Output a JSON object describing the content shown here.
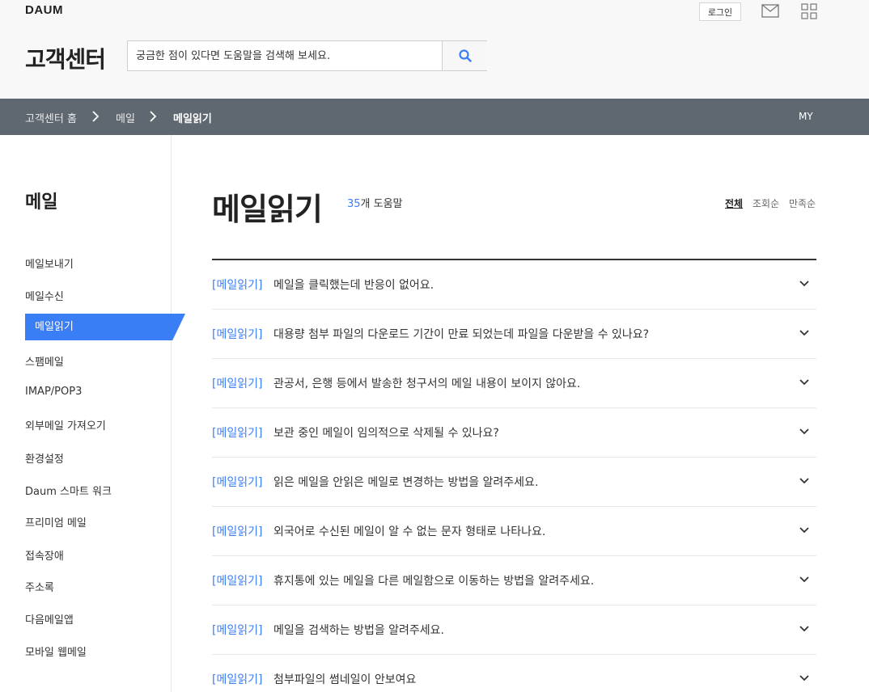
{
  "header": {
    "logo": "DAUM",
    "login_label": "로그인",
    "title": "고객센터",
    "search_placeholder": "궁금한 점이 있다면 도움말을 검색해 보세요."
  },
  "breadcrumb": {
    "items": [
      "고객센터 홈",
      "메일",
      "메일읽기"
    ],
    "my_label": "MY"
  },
  "sidebar": {
    "title": "메일",
    "items": [
      "메일보내기",
      "메일수신",
      "메일읽기",
      "스팸메일",
      "IMAP/POP3",
      "외부메일 가져오기",
      "환경설정",
      "Daum 스마트 워크",
      "프리미엄 메일",
      "접속장애",
      "주소록",
      "다음메일앱",
      "모바일 웹메일"
    ],
    "active_index": 2
  },
  "main": {
    "title": "메일읽기",
    "count_number": "35",
    "count_label": "개 도움말",
    "sort": [
      "전체",
      "조회순",
      "만족순"
    ],
    "faqs": [
      {
        "category": "[메일읽기]",
        "text": "메일을 클릭했는데 반응이 없어요."
      },
      {
        "category": "[메일읽기]",
        "text": "대용량 첨부 파일의 다운로드 기간이 만료 되었는데 파일을 다운받을 수 있나요?"
      },
      {
        "category": "[메일읽기]",
        "text": "관공서, 은행 등에서 발송한 청구서의 메일 내용이 보이지 않아요."
      },
      {
        "category": "[메일읽기]",
        "text": "보관 중인 메일이 임의적으로 삭제될 수 있나요?"
      },
      {
        "category": "[메일읽기]",
        "text": "읽은 메일을 안읽은 메일로 변경하는 방법을 알려주세요."
      },
      {
        "category": "[메일읽기]",
        "text": "외국어로 수신된 메일이 알 수 없는 문자 형태로 나타나요."
      },
      {
        "category": "[메일읽기]",
        "text": "휴지통에 있는 메일을 다른 메일함으로 이동하는 방법을 알려주세요."
      },
      {
        "category": "[메일읽기]",
        "text": "메일을 검색하는 방법을 알려주세요."
      },
      {
        "category": "[메일읽기]",
        "text": "첨부파일의 썸네일이 안보여요"
      }
    ]
  },
  "colors": {
    "accent": "#3a7ef5",
    "breadcrumb_bg": "#5f6770",
    "header_bg": "#f8f8f8"
  }
}
